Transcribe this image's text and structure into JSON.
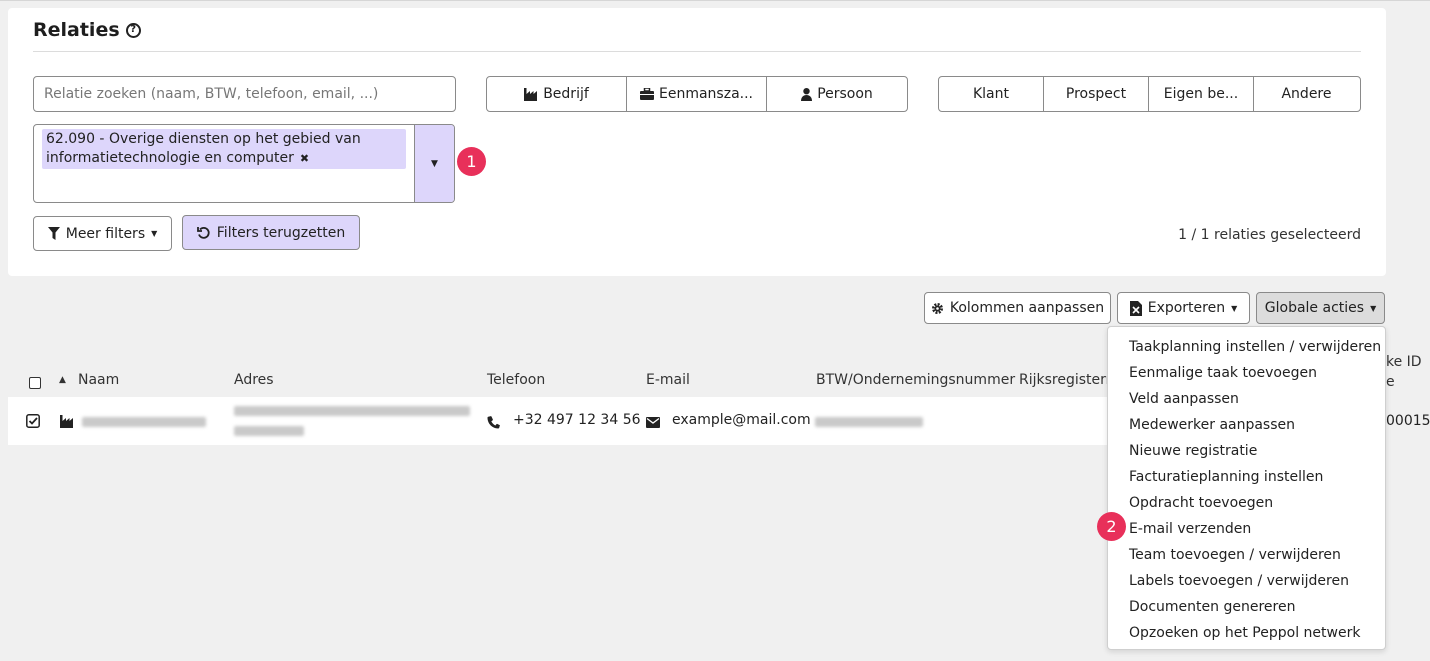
{
  "page": {
    "title": "Relaties"
  },
  "search": {
    "placeholder": "Relatie zoeken (naam, BTW, telefoon, email, ...)"
  },
  "type_filter": [
    {
      "label": "Bedrijf",
      "icon": "factory-icon"
    },
    {
      "label": "Eenmansza...",
      "icon": "briefcase-icon"
    },
    {
      "label": "Persoon",
      "icon": "user-icon"
    }
  ],
  "status_filter": [
    "Klant",
    "Prospect",
    "Eigen be...",
    "Andere"
  ],
  "nace_tag": {
    "label": "62.090 - Overige diensten op het gebied van informatietechnologie en computer"
  },
  "badges": [
    "1",
    "2"
  ],
  "buttons": {
    "meer_filters": "Meer filters",
    "filters_terugzetten": "Filters terugzetten",
    "kolommen": "Kolommen aanpassen",
    "exporteren": "Exporteren",
    "globale_acties": "Globale acties"
  },
  "selection_count": "1 / 1 relaties geselecteerd",
  "table": {
    "columns": [
      "Naam",
      "Adres",
      "Telefoon",
      "E-mail",
      "BTW/Ondernemingsnummer",
      "Rijksregisterm"
    ],
    "overflow_column": [
      "ke ID",
      "e"
    ],
    "row": {
      "phone": "+32 497 12 34 56",
      "email": "example@mail.com",
      "id_tail": "00015"
    }
  },
  "global_actions_menu": [
    "Taakplanning instellen / verwijderen",
    "Eenmalige taak toevoegen",
    "Veld aanpassen",
    "Medewerker aanpassen",
    "Nieuwe registratie",
    "Facturatieplanning instellen",
    "Opdracht toevoegen",
    "E-mail verzenden",
    "Team toevoegen / verwijderen",
    "Labels toevoegen / verwijderen",
    "Documenten genereren",
    "Opzoeken op het Peppol netwerk"
  ],
  "colors": {
    "accent_purple": "#ddd6fb",
    "badge_red": "#e8305a"
  }
}
